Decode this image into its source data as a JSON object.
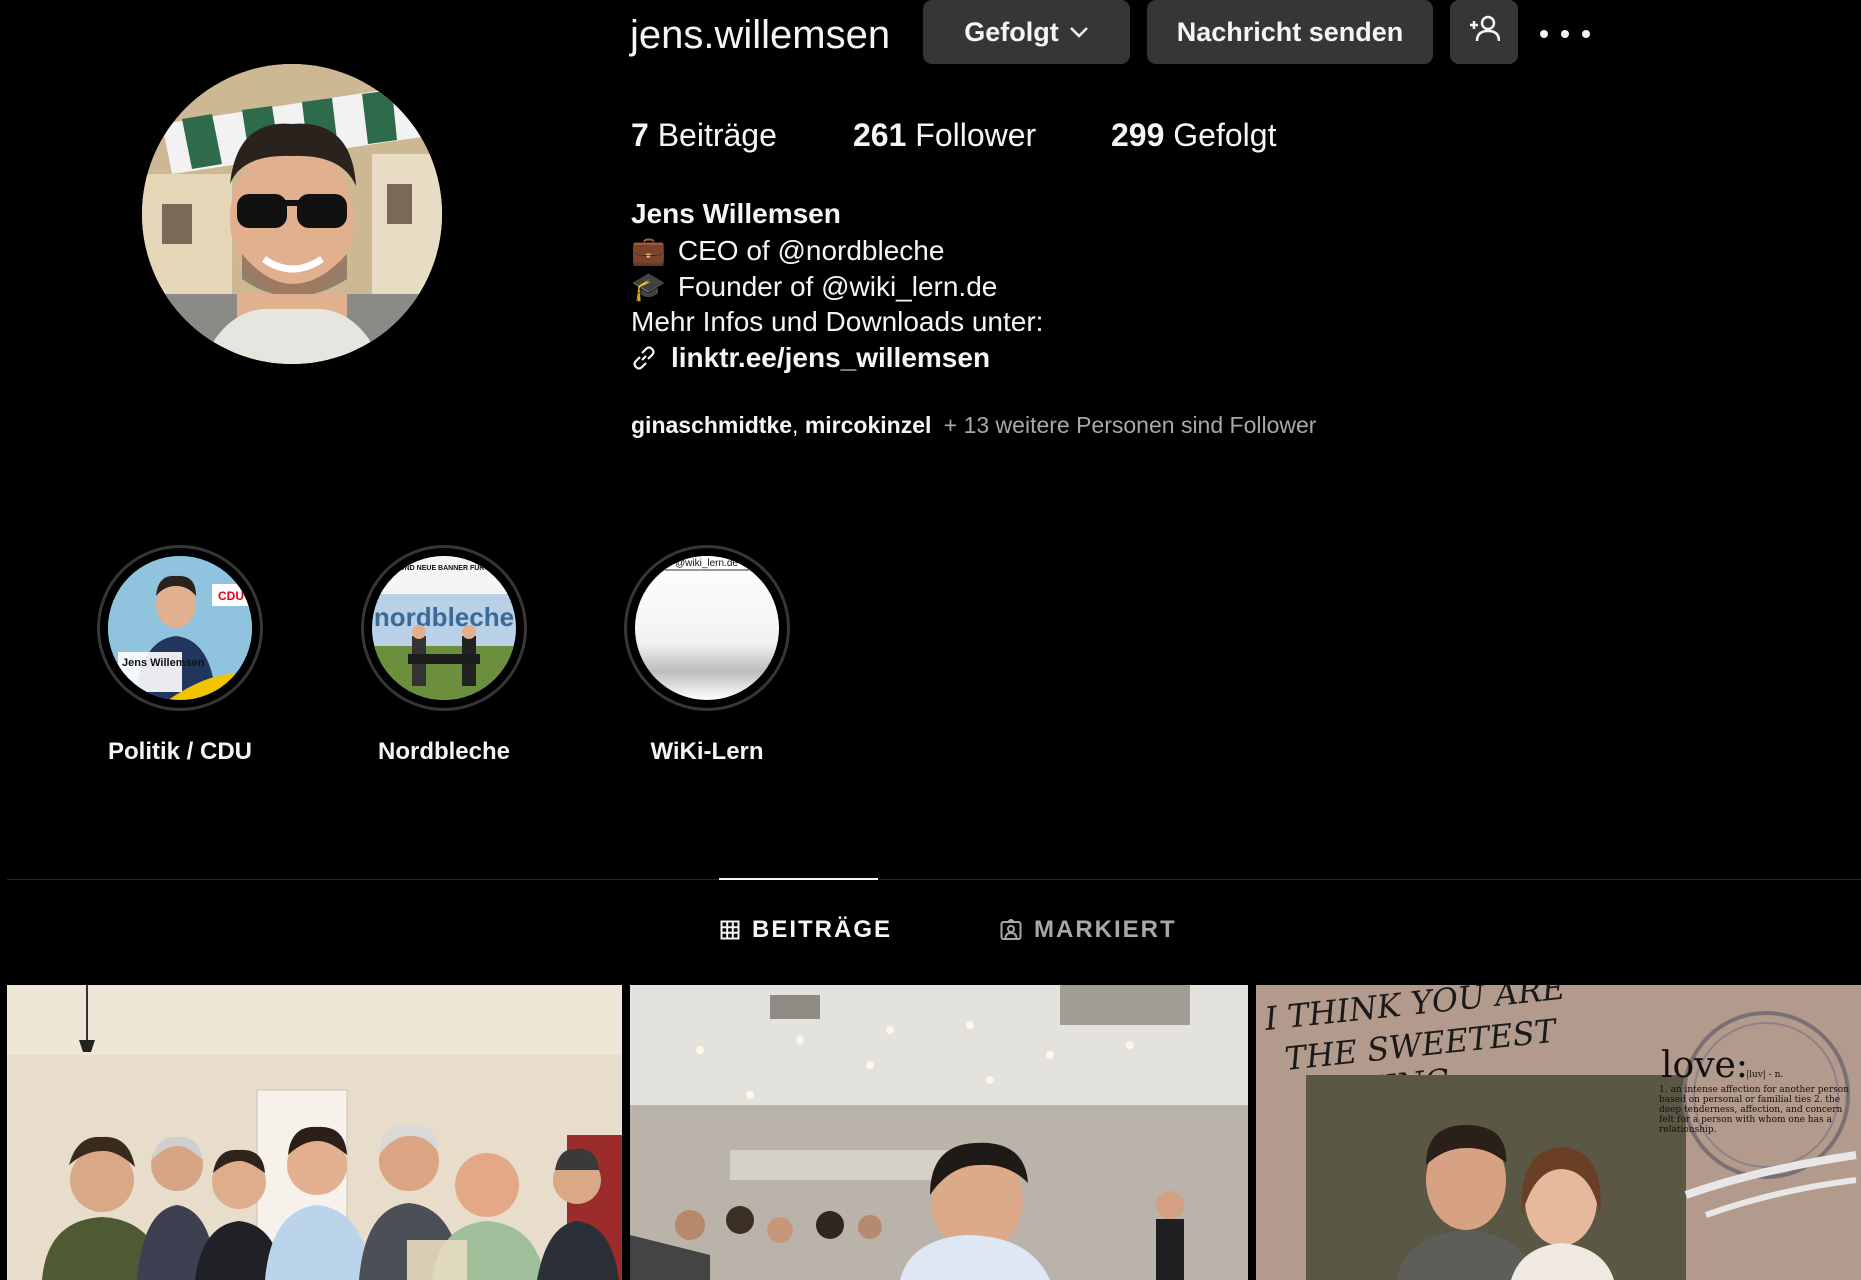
{
  "profile": {
    "username": "jens.willemsen",
    "follow_button": "Gefolgt",
    "message_button": "Nachricht senden",
    "stats": [
      {
        "count": "7",
        "label": "Beiträge"
      },
      {
        "count": "261",
        "label": "Follower"
      },
      {
        "count": "299",
        "label": "Gefolgt"
      }
    ],
    "full_name": "Jens Willemsen",
    "bio": {
      "line1_emoji": "💼",
      "line1": "CEO of @nordbleche",
      "line2_emoji": "🎓",
      "line2": "Founder of @wiki_lern.de",
      "line3": "Mehr Infos und Downloads unter:",
      "link": "linktr.ee/jens_willemsen"
    },
    "followed_by": {
      "user1": "ginaschmidtke",
      "separator": ",",
      "user2": "mircokinzel",
      "rest": "+ 13 weitere Personen sind Follower"
    }
  },
  "highlights": [
    {
      "label": "Politik / CDU",
      "thumb_text": "Jens Willemsen"
    },
    {
      "label": "Nordbleche",
      "thumb_text": "nordbleche",
      "thumb_caption": "EINE NEUE ZAUNANLAGE UND NEUE BANNER FÜR DEN @TSV1920WETSCHEN"
    },
    {
      "label": "WiKi-Lern",
      "thumb_text": "@wiki_lern.de"
    }
  ],
  "tabs": [
    {
      "label": "BEITRÄGE",
      "icon": "grid-icon",
      "active": true
    },
    {
      "label": "MARKIERT",
      "icon": "tagged-icon",
      "active": false
    }
  ],
  "posts": [
    {
      "type": "photo",
      "description": "group"
    },
    {
      "type": "photo",
      "description": "event"
    },
    {
      "type": "graphic",
      "headline_line1": "I THINK YOU ARE",
      "headline_line2": "THE SWEETEST",
      "headline_line3": "THING",
      "definition_word": "love:",
      "definition_phon": "|luv| - n.",
      "definition_text": "1. an intense affection for another person based on personal or familial ties 2. the deep tenderness, affection, and concern felt for a person with whom one has a relationship."
    }
  ],
  "colors": {
    "background": "#000000",
    "button": "#363636",
    "muted": "#a8a8a8",
    "divider": "#262626"
  }
}
